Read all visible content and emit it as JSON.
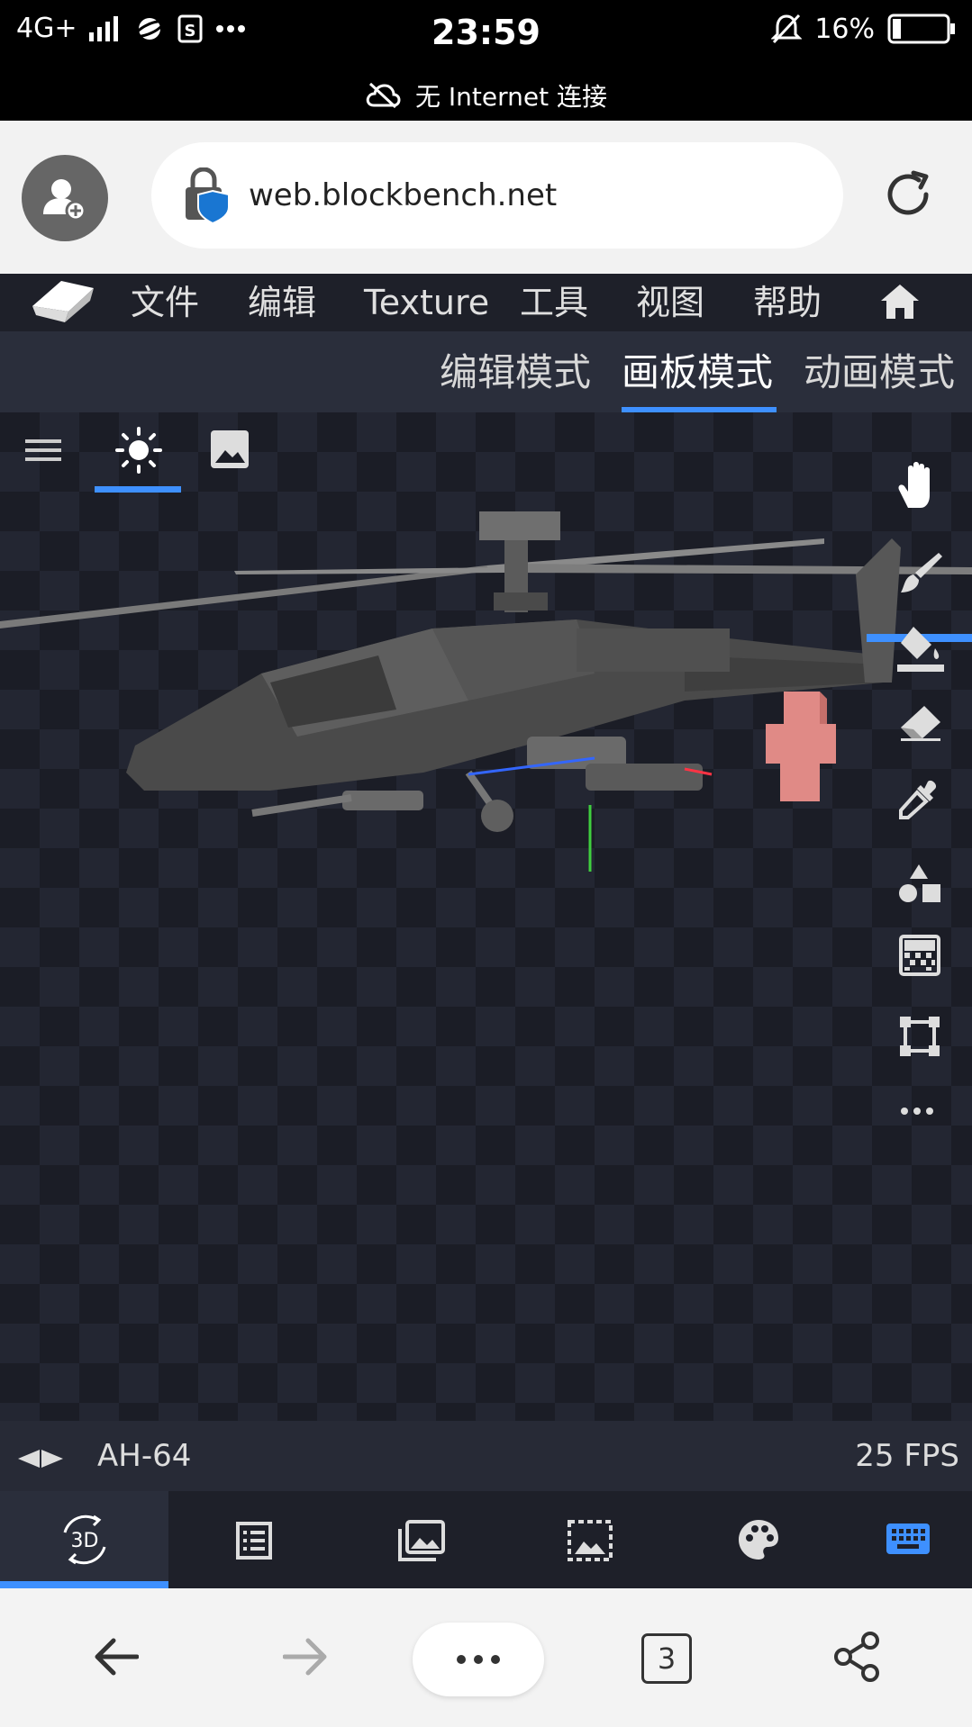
{
  "status_bar": {
    "network": "4G+",
    "time": "23:59",
    "battery": "16%",
    "no_internet": "无 Internet 连接",
    "icons": [
      "signal-icon",
      "planet-icon",
      "sim-s-icon",
      "more-dots-icon",
      "bell-off-icon",
      "battery-icon",
      "cloud-off-icon"
    ]
  },
  "browser": {
    "url": "web.blockbench.net",
    "tab_count": "3",
    "icons": [
      "add-user-icon",
      "lock-shield-icon",
      "reload-icon",
      "back-arrow-icon",
      "forward-arrow-icon",
      "more-icon",
      "tabs-icon",
      "share-icon"
    ]
  },
  "menu": {
    "items": [
      "文件",
      "编辑",
      "Texture",
      "工具",
      "视图",
      "帮助"
    ],
    "icons": [
      "blockbench-logo-icon",
      "home-icon"
    ]
  },
  "modes": {
    "tabs": [
      "编辑模式",
      "画板模式",
      "动画模式"
    ],
    "active": "画板模式"
  },
  "viewport": {
    "left_tools": [
      "hamburger-menu-icon",
      "sun-icon",
      "image-icon"
    ],
    "right_tools": [
      "hand-icon",
      "brush-icon",
      "fill-bucket-icon",
      "eraser-icon",
      "color-picker-icon",
      "shapes-icon",
      "gradient-icon",
      "selection-icon",
      "more-icon"
    ],
    "model_description": "AH-64"
  },
  "status_line": {
    "model_name": "AH-64",
    "fps": "25 FPS"
  },
  "panel_tabs": [
    "3d-view-icon",
    "outliner-icon",
    "textures-icon",
    "uv-icon",
    "palette-icon",
    "keyboard-icon"
  ],
  "colors": {
    "accent": "#3e90ff",
    "background": "#1b1d26",
    "highlight_cube": "#e08a86"
  }
}
